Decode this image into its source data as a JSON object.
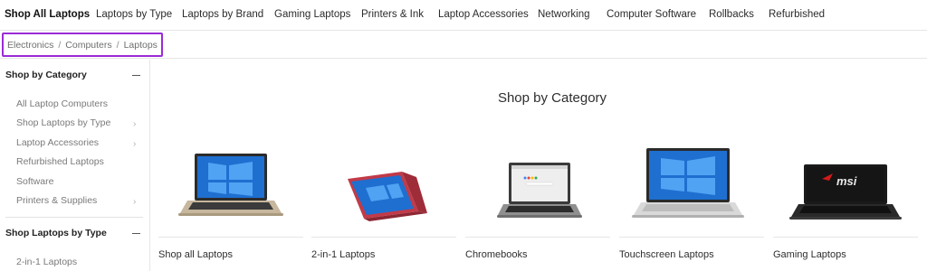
{
  "topnav": {
    "items": [
      {
        "label": "Shop All Laptops",
        "active": true
      },
      {
        "label": "Laptops by Type"
      },
      {
        "label": "Laptops by Brand"
      },
      {
        "label": "Gaming Laptops"
      },
      {
        "label": "Printers & Ink"
      },
      {
        "label": "Laptop Accessories"
      },
      {
        "label": "Networking"
      },
      {
        "label": "Computer Software"
      },
      {
        "label": "Rollbacks"
      },
      {
        "label": "Refurbished"
      }
    ]
  },
  "breadcrumb": {
    "items": [
      "Electronics",
      "Computers",
      "Laptops"
    ],
    "separator": "/"
  },
  "sidebar": {
    "sections": [
      {
        "title": "Shop by Category",
        "items": [
          {
            "label": "All Laptop Computers",
            "has_submenu": false
          },
          {
            "label": "Shop Laptops by Type",
            "has_submenu": true
          },
          {
            "label": "Laptop Accessories",
            "has_submenu": true
          },
          {
            "label": "Refurbished Laptops",
            "has_submenu": false
          },
          {
            "label": "Software",
            "has_submenu": false
          },
          {
            "label": "Printers & Supplies",
            "has_submenu": true
          }
        ]
      },
      {
        "title": "Shop Laptops by Type",
        "items": [
          {
            "label": "2-in-1 Laptops",
            "has_submenu": false
          }
        ]
      }
    ]
  },
  "main": {
    "title": "Shop by Category",
    "categories": [
      {
        "label": "Shop all Laptops",
        "image": "laptop-silver-windows-image"
      },
      {
        "label": "2-in-1 Laptops",
        "image": "laptop-red-2in1-image"
      },
      {
        "label": "Chromebooks",
        "image": "chromebook-gray-image"
      },
      {
        "label": "Touchscreen Laptops",
        "image": "laptop-touchscreen-silver-image"
      },
      {
        "label": "Gaming Laptops",
        "image": "laptop-gaming-msi-image"
      }
    ],
    "brand_text_on_gaming_laptop": "msi"
  },
  "colors": {
    "highlight_border": "#9b2bd6",
    "red_laptop": "#c23a48",
    "msi_red": "#d21a1a",
    "windows_blue": "#1e6fd0"
  }
}
